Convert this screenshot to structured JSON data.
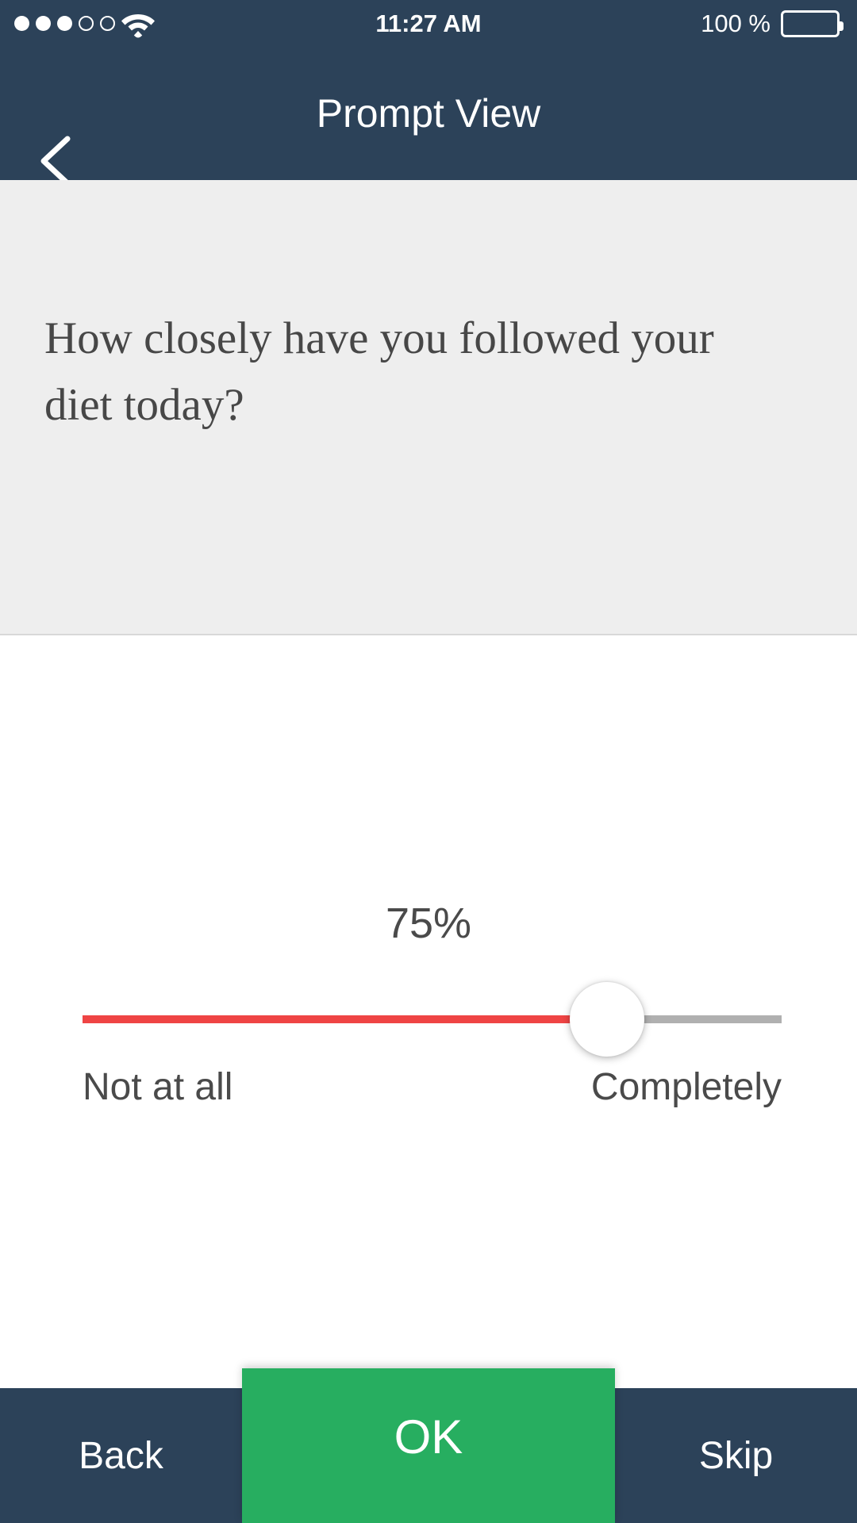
{
  "status_bar": {
    "time": "11:27 AM",
    "battery_percent": "100 %",
    "signal_dots_filled": 3,
    "signal_dots_total": 5,
    "wifi_icon": "wifi-icon",
    "battery_icon": "battery-full-icon"
  },
  "nav_bar": {
    "title": "Prompt View",
    "back_icon": "chevron-left-icon"
  },
  "question": {
    "text": "How closely have you followed your diet today?"
  },
  "slider": {
    "value_label": "75%",
    "value": 75,
    "min": 0,
    "max": 100,
    "min_label": "Not at all",
    "max_label": "Completely",
    "fill_color": "#ef4444",
    "track_color": "#b0b0b0",
    "thumb_color": "#ffffff"
  },
  "bottom_bar": {
    "back_label": "Back",
    "ok_label": "OK",
    "skip_label": "Skip",
    "ok_color": "#27ae60",
    "bar_color": "#2c4259"
  }
}
